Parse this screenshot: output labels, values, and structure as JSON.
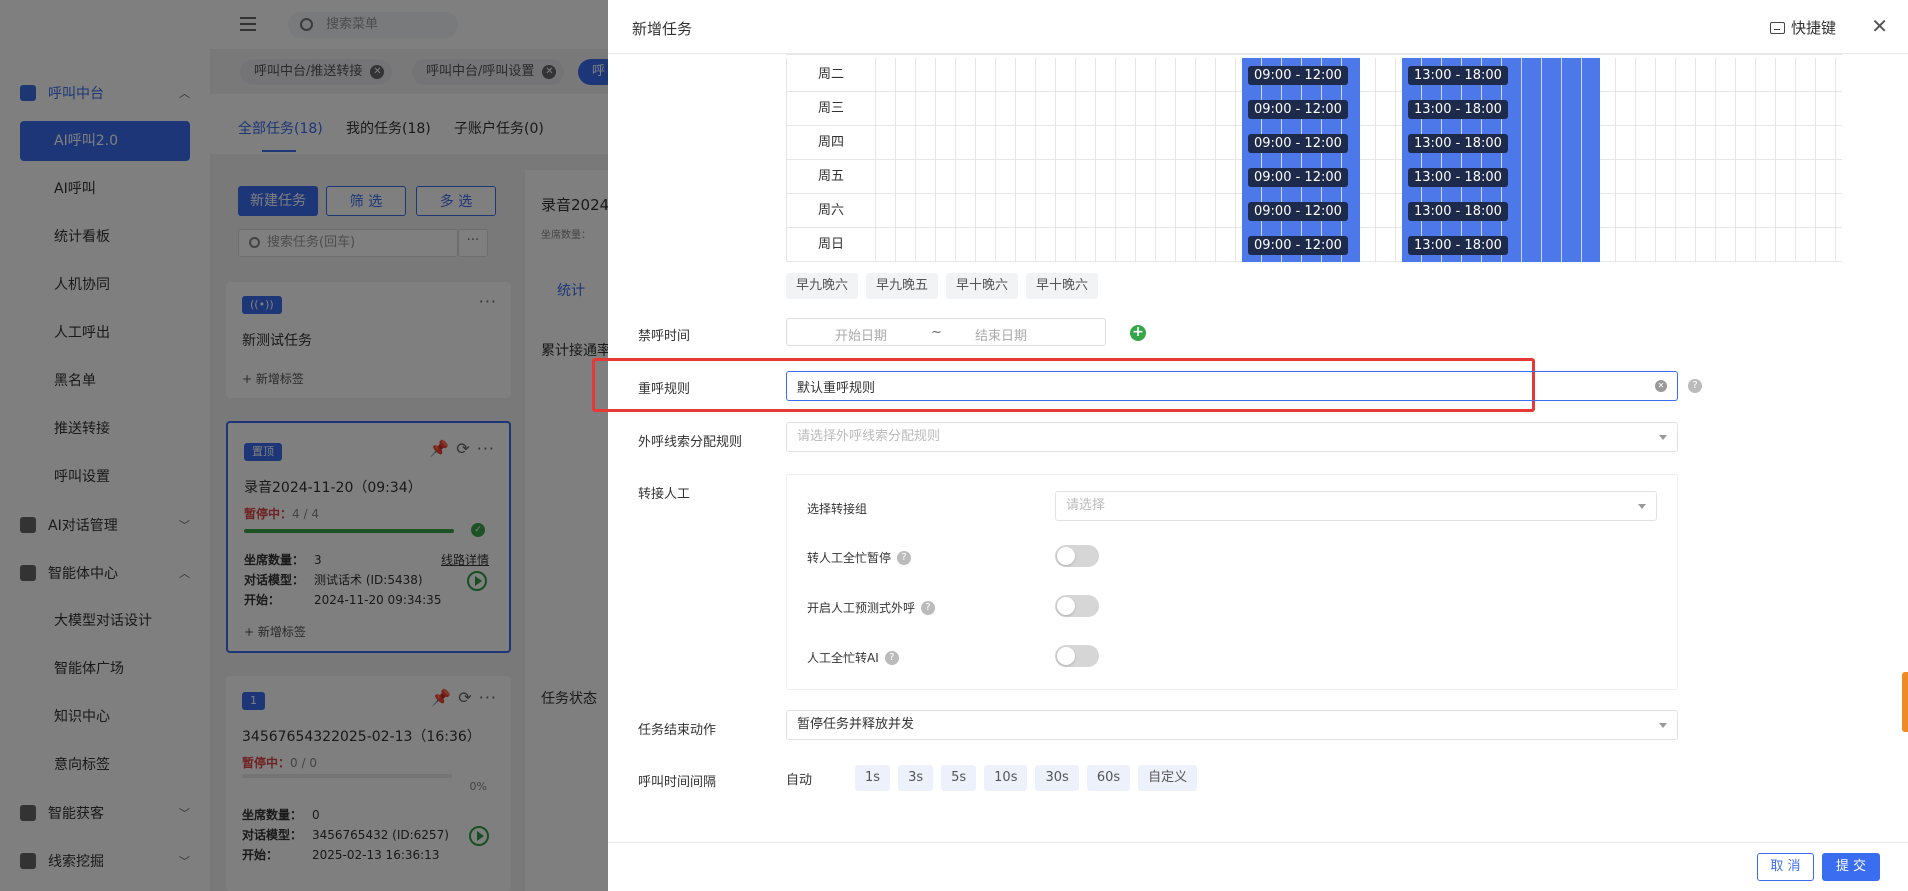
{
  "sidebar": {
    "groups": [
      {
        "label": "呼叫中台",
        "icon": "monitor-icon",
        "expanded": true
      },
      {
        "label": "AI对话管理",
        "icon": "book-icon",
        "expanded": false
      },
      {
        "label": "智能体中心",
        "icon": "folder-icon",
        "expanded": true
      },
      {
        "label": "智能获客",
        "icon": "search-user-icon",
        "expanded": false
      },
      {
        "label": "线索挖掘",
        "icon": "target-icon",
        "expanded": false
      }
    ],
    "items": [
      "AI呼叫2.0",
      "AI呼叫",
      "统计看板",
      "人机协同",
      "人工呼出",
      "黑名单",
      "推送转接",
      "呼叫设置"
    ],
    "agent_items": [
      "大模型对话设计",
      "智能体广场",
      "知识中心",
      "意向标签"
    ]
  },
  "topbar": {
    "search_placeholder": "搜索菜单"
  },
  "page_tabs": [
    "呼叫中台/推送转接",
    "呼叫中台/呼叫设置",
    "呼"
  ],
  "content_tabs": {
    "all": "全部任务(18)",
    "mine": "我的任务(18)",
    "sub": "子账户任务(0)"
  },
  "task_toolbar": {
    "new": "新建任务",
    "filter": "筛 选",
    "multi": "多 选",
    "search_placeholder": "搜索任务(回车)",
    "more": "···"
  },
  "tasks": [
    {
      "badge": "((•))",
      "title": "新测试任务",
      "add_tag": "+ 新增标签"
    },
    {
      "badge": "置顶",
      "title": "录音2024-11-20（09:34）",
      "status": "暂停中：",
      "count": "4 / 4",
      "progress": 1.0,
      "seats_label": "坐席数量：",
      "seats": "3",
      "model_label": "对话模型：",
      "model": "测试话术 (ID:5438)",
      "start_label": "开始：",
      "start": "2024-11-20 09:34:35",
      "link": "线路详情",
      "add_tag": "+ 新增标签"
    },
    {
      "badge": "1",
      "title": "34567654322025-02-13（16:36）",
      "status": "暂停中：",
      "count": "0 / 0",
      "progress": 0.0,
      "percent": "0%",
      "seats_label": "坐席数量：",
      "seats": "0",
      "model_label": "对话模型：",
      "model": "3456765432 (ID:6257)",
      "start_label": "开始：",
      "start": "2025-02-13 16:36:13"
    }
  ],
  "detail": {
    "title": "录音2024",
    "seats": "坐席数量：",
    "tab": "统计",
    "cumulative": "累计接通率",
    "status": "任务状态"
  },
  "drawer": {
    "title": "新增任务",
    "shortcut": "快捷键",
    "schedule": {
      "days": [
        "周二",
        "周三",
        "周四",
        "周五",
        "周六",
        "周日"
      ],
      "morning": "09:00 - 12:00",
      "afternoon": "13:00 - 18:00",
      "presets": [
        "早九晚六",
        "早九晚五",
        "早十晚六",
        "早十晚六"
      ]
    },
    "no_call": {
      "label": "禁呼时间",
      "start_placeholder": "开始日期",
      "sep": "~",
      "end_placeholder": "结束日期"
    },
    "retry": {
      "label": "重呼规则",
      "value": "默认重呼规则"
    },
    "allocation": {
      "label": "外呼线索分配规则",
      "placeholder": "请选择外呼线索分配规则"
    },
    "transfer": {
      "label": "转接人工",
      "group_label": "选择转接组",
      "group_placeholder": "请选择",
      "toggles": [
        {
          "label": "转人工全忙暂停",
          "on": false
        },
        {
          "label": "开启人工预测式外呼",
          "on": false
        },
        {
          "label": "人工全忙转AI",
          "on": false
        }
      ]
    },
    "end_action": {
      "label": "任务结束动作",
      "value": "暂停任务并释放并发"
    },
    "interval": {
      "label": "呼叫时间间隔",
      "auto": "自动",
      "options": [
        "1s",
        "3s",
        "5s",
        "10s",
        "30s",
        "60s",
        "自定义"
      ]
    },
    "footer": {
      "cancel": "取 消",
      "submit": "提 交"
    }
  }
}
